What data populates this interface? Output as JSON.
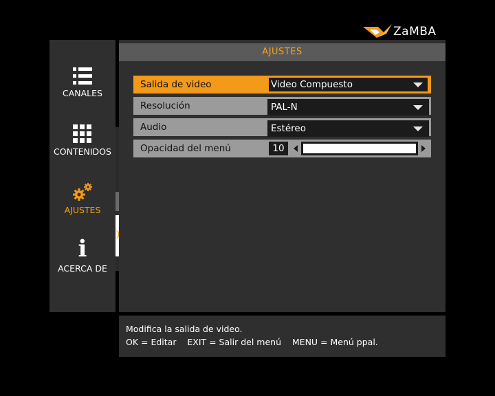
{
  "brand": {
    "name": "ZaMBA",
    "accent": "#f39a1a"
  },
  "sidebar": {
    "items": [
      {
        "label": "CANALES",
        "icon": "list-icon",
        "active": false
      },
      {
        "label": "CONTENIDOS",
        "icon": "grid-icon",
        "active": false
      },
      {
        "label": "AJUSTES",
        "icon": "gears-icon",
        "active": true
      },
      {
        "label": "ACERCA DE",
        "icon": "info-icon",
        "active": false
      }
    ]
  },
  "main": {
    "title": "AJUSTES",
    "rows": [
      {
        "label": "Salida de video",
        "value": "Video Compuesto",
        "type": "dropdown",
        "selected": true
      },
      {
        "label": "Resolución",
        "value": "PAL-N",
        "type": "dropdown",
        "selected": false
      },
      {
        "label": "Audio",
        "value": "Estéreo",
        "type": "dropdown",
        "selected": false
      },
      {
        "label": "Opacidad del menú",
        "value": "10",
        "type": "slider",
        "level": 1.0,
        "selected": false
      }
    ]
  },
  "footer": {
    "description": "Modifica la salida de video.",
    "keys": "OK = Editar    EXIT = Salir del menú    MENU = Menú ppal."
  }
}
